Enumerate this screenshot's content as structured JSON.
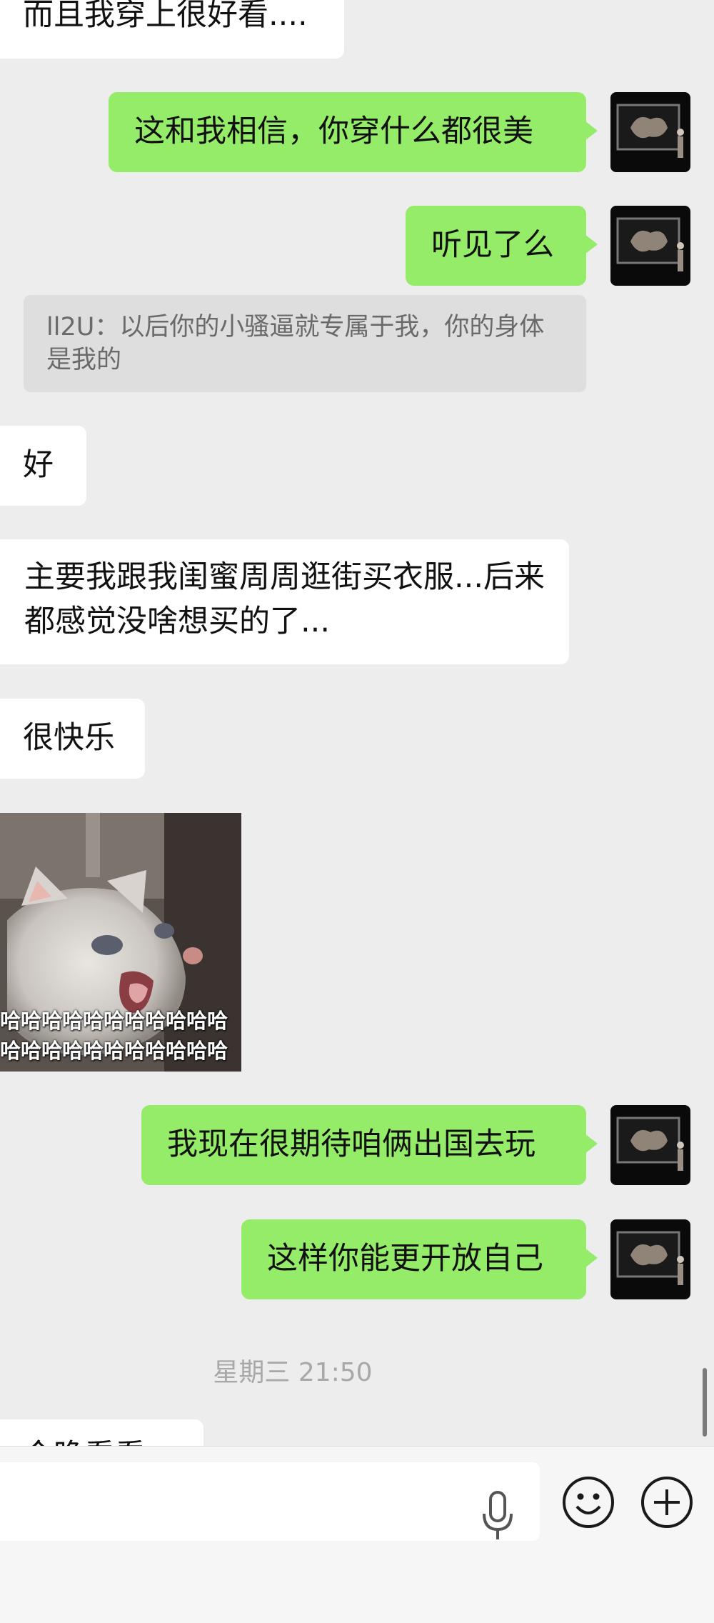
{
  "messages": {
    "m1": "而且我穿上很好看....",
    "m2": "这和我相信，你穿什么都很美",
    "m3": "听见了么",
    "quote": "ll2U：以后你的小骚逼就专属于我，你的身体是我的",
    "m4": "好",
    "m5": "主要我跟我闺蜜周周逛街买衣服...后来都感觉没啥想买的了...",
    "m6": "很快乐",
    "sticker_caption_1": "哈哈哈哈哈哈哈哈哈哈哈",
    "sticker_caption_2": "哈哈哈哈哈哈哈哈哈哈哈",
    "m7": "我现在很期待咱俩出国去玩",
    "m8": "这样你能更开放自己",
    "timestamp": "星期三 21:50",
    "m9_partial": "今晚看看"
  },
  "input_bar": {
    "icons": [
      "microphone-icon",
      "emoji-icon",
      "plus-icon"
    ]
  },
  "colors": {
    "background": "#ededed",
    "outgoing_bubble": "#95ec69",
    "incoming_bubble": "#ffffff",
    "quote_bg": "#dedede"
  }
}
